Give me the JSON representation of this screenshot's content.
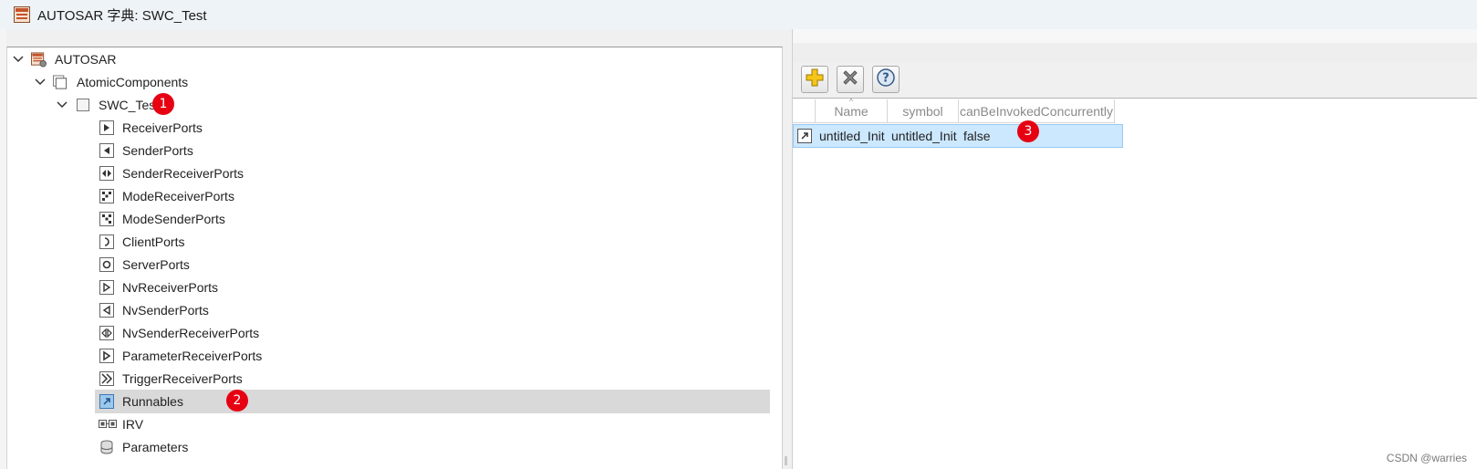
{
  "window": {
    "title": "AUTOSAR 字典: SWC_Test"
  },
  "tree": {
    "root": {
      "label": "AUTOSAR",
      "icon": "autosar-dictionary-icon"
    },
    "atomic": {
      "label": "AtomicComponents",
      "icon": "components-folder-icon"
    },
    "component": {
      "label": "SWC_Test",
      "icon": "component-box-icon"
    },
    "items": [
      {
        "label": "ReceiverPorts",
        "icon": "receiver-port-icon"
      },
      {
        "label": "SenderPorts",
        "icon": "sender-port-icon"
      },
      {
        "label": "SenderReceiverPorts",
        "icon": "sender-receiver-port-icon"
      },
      {
        "label": "ModeReceiverPorts",
        "icon": "mode-receiver-port-icon"
      },
      {
        "label": "ModeSenderPorts",
        "icon": "mode-sender-port-icon"
      },
      {
        "label": "ClientPorts",
        "icon": "client-port-icon"
      },
      {
        "label": "ServerPorts",
        "icon": "server-port-icon"
      },
      {
        "label": "NvReceiverPorts",
        "icon": "nv-receiver-port-icon"
      },
      {
        "label": "NvSenderPorts",
        "icon": "nv-sender-port-icon"
      },
      {
        "label": "NvSenderReceiverPorts",
        "icon": "nv-sender-receiver-port-icon"
      },
      {
        "label": "ParameterReceiverPorts",
        "icon": "parameter-receiver-port-icon"
      },
      {
        "label": "TriggerReceiverPorts",
        "icon": "trigger-receiver-port-icon"
      },
      {
        "label": "Runnables",
        "icon": "runnable-icon",
        "selected": true
      },
      {
        "label": "IRV",
        "icon": "irv-icon"
      },
      {
        "label": "Parameters",
        "icon": "parameters-icon"
      }
    ]
  },
  "toolbar": {
    "add": {
      "icon": "add-icon"
    },
    "delete": {
      "icon": "delete-icon"
    },
    "help": {
      "icon": "help-icon"
    }
  },
  "table": {
    "columns": [
      "Name",
      "symbol",
      "canBeInvokedConcurrently"
    ],
    "rows": [
      {
        "icon": "runnable-icon",
        "name": "untitled_Init",
        "symbol": "untitled_Init",
        "concurrent": "false"
      }
    ]
  },
  "badges": [
    "1",
    "2",
    "3"
  ],
  "watermark": "CSDN @warries",
  "colors": {
    "badge": "#e60012",
    "selected_row": "#cce8ff",
    "tree_selection": "#d9d9d9"
  }
}
